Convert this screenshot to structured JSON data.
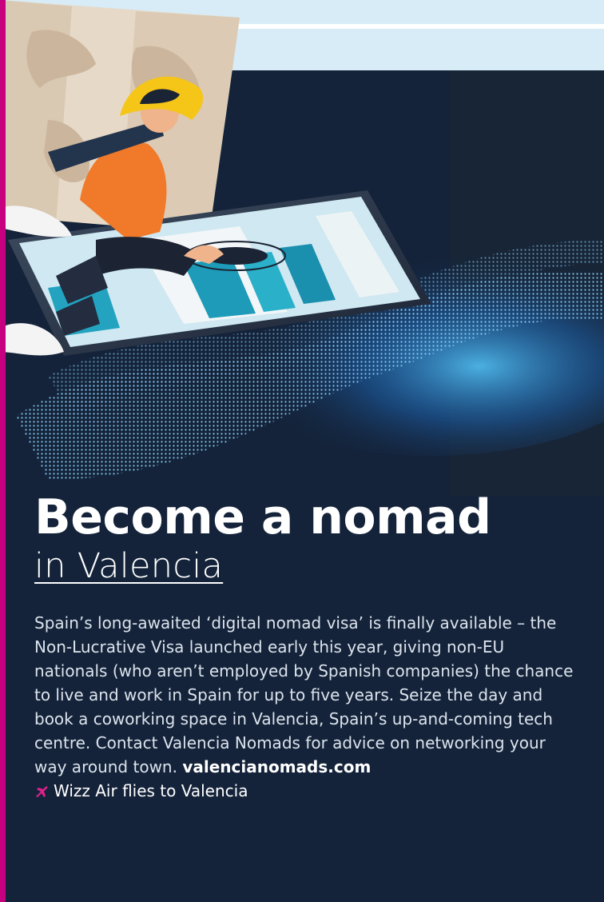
{
  "article": {
    "headline": "Become a nomad",
    "subheadline": "in Valencia",
    "body": "Spain’s long-awaited ‘digital nomad visa’ is finally available – the Non-Lucrative Visa launched early this year, giving non-EU nationals (who aren’t employed by Spanish companies) the chance to live and work in Spain for up to five years. Seize the day and book a coworking space in Valencia, Spain’s up-and-coming tech centre. Contact Valencia Nomads for advice on networking your way around town.",
    "website": "valencianomads.com",
    "flight_note": "Wizz Air flies to Valencia",
    "flight_icon": "plane-icon"
  },
  "colors": {
    "background": "#14233a",
    "accent": "#c6007e",
    "headline": "#ffffff",
    "body_text": "#dbe3ec"
  }
}
